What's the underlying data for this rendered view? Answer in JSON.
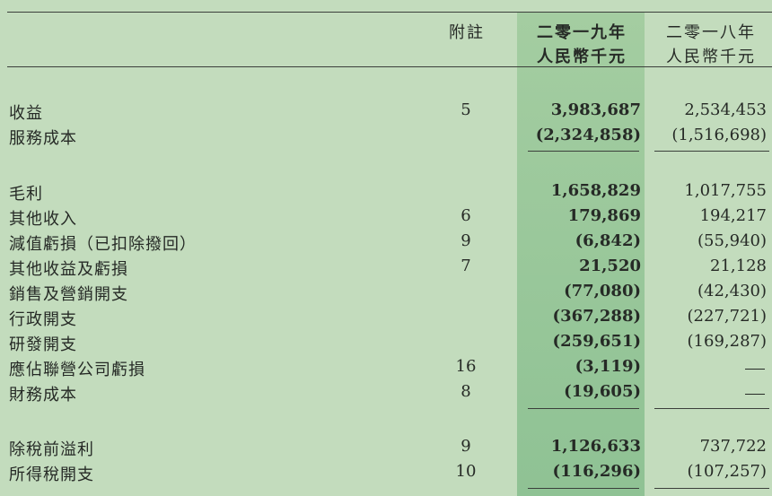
{
  "header": {
    "note_label": "附註",
    "current_year": "二零一九年",
    "current_unit": "人民幣千元",
    "prior_year": "二零一八年",
    "prior_unit": "人民幣千元"
  },
  "rows": [
    {
      "label": "收益",
      "note": "5",
      "current": "3,983,687",
      "prior": "2,534,453"
    },
    {
      "label": "服務成本",
      "note": "",
      "current": "(2,324,858)",
      "prior": "(1,516,698)"
    },
    {
      "label": "毛利",
      "note": "",
      "current": "1,658,829",
      "prior": "1,017,755"
    },
    {
      "label": "其他收入",
      "note": "6",
      "current": "179,869",
      "prior": "194,217"
    },
    {
      "label": "減值虧損（已扣除撥回）",
      "note": "9",
      "current": "(6,842)",
      "prior": "(55,940)"
    },
    {
      "label": "其他收益及虧損",
      "note": "7",
      "current": "21,520",
      "prior": "21,128"
    },
    {
      "label": "銷售及營銷開支",
      "note": "",
      "current": "(77,080)",
      "prior": "(42,430)"
    },
    {
      "label": "行政開支",
      "note": "",
      "current": "(367,288)",
      "prior": "(227,721)"
    },
    {
      "label": "研發開支",
      "note": "",
      "current": "(259,651)",
      "prior": "(169,287)"
    },
    {
      "label": "應佔聯營公司虧損",
      "note": "16",
      "current": "(3,119)",
      "prior": "—"
    },
    {
      "label": "財務成本",
      "note": "8",
      "current": "(19,605)",
      "prior": "—"
    },
    {
      "label": "除稅前溢利",
      "note": "9",
      "current": "1,126,633",
      "prior": "737,722"
    },
    {
      "label": "所得稅開支",
      "note": "10",
      "current": "(116,296)",
      "prior": "(107,257)"
    }
  ]
}
